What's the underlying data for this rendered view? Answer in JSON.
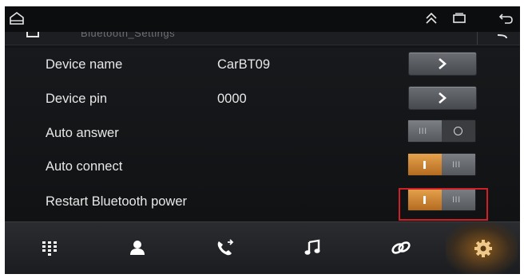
{
  "window": {
    "title": "Bluetooth_Settings"
  },
  "statusbar": {
    "icons": [
      "home-outline-icon",
      "double-chevron-up-icon",
      "recent-apps-icon",
      "back-icon"
    ]
  },
  "settings": [
    {
      "label": "Device name",
      "value": "CarBT09",
      "control": "arrow-button"
    },
    {
      "label": "Device pin",
      "value": "0000",
      "control": "arrow-button"
    },
    {
      "label": "Auto answer",
      "value": "",
      "control": "toggle",
      "state": "off"
    },
    {
      "label": "Auto connect",
      "value": "",
      "control": "toggle",
      "state": "on"
    },
    {
      "label": "Restart Bluetooth power",
      "value": "",
      "control": "toggle",
      "state": "on",
      "highlighted": true
    }
  ],
  "toggle_glyphs": {
    "off_ticks": "III"
  },
  "navbar": [
    {
      "icon": "dialpad-icon",
      "active": false
    },
    {
      "icon": "contacts-icon",
      "active": false
    },
    {
      "icon": "call-log-icon",
      "active": false
    },
    {
      "icon": "music-icon",
      "active": false
    },
    {
      "icon": "link-icon",
      "active": false
    },
    {
      "icon": "settings-gear-icon",
      "active": true
    }
  ],
  "colors": {
    "accent": "#d98d36",
    "highlight": "#d21f26",
    "background": "#121416",
    "text": "#e8e8e8"
  }
}
